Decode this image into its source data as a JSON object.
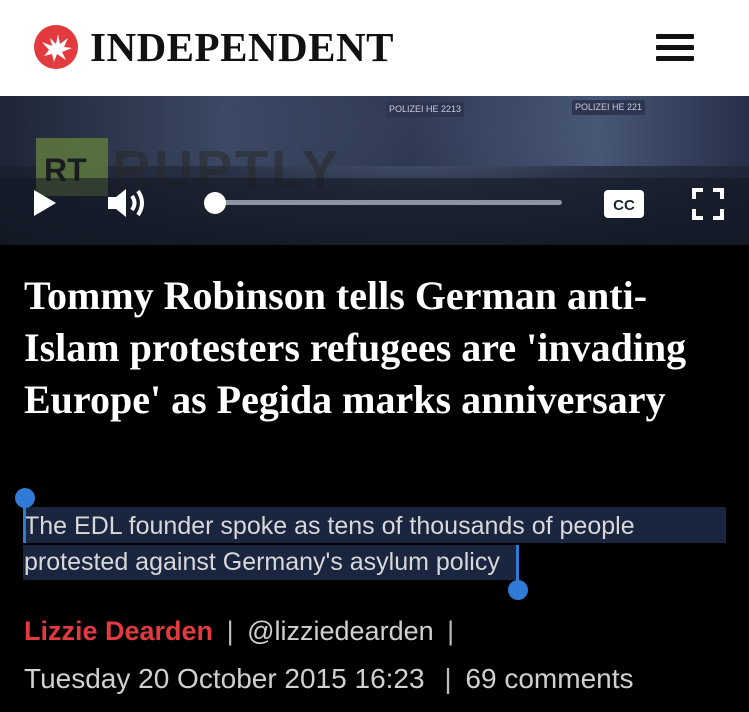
{
  "header": {
    "logo_text": "INDEPENDENT",
    "logo_icon": "eagle-icon",
    "menu_icon": "hamburger-menu-icon",
    "accent_color": "#e33a3f"
  },
  "video": {
    "watermark_badge": "RT",
    "watermark_text": "RUPTLY",
    "police_badges": [
      "POLIZEI HE 2213",
      "POLIZEI HE 221"
    ],
    "controls": {
      "play_icon": "play-icon",
      "volume_icon": "volume-icon",
      "progress": 0.0,
      "captions_label": "CC",
      "fullscreen_icon": "fullscreen-icon"
    }
  },
  "article": {
    "headline": "Tommy Robinson tells German anti-Islam protesters refugees are 'invading Europe' as Pegida marks anniversary",
    "standfirst": "The EDL founder spoke as tens of thousands of people protested against Germany's asylum policy",
    "author": "Lizzie Dearden",
    "handle": "@lizziedearden",
    "separator": "|",
    "date": "Tuesday 20 October 2015 16:23",
    "comments": "69 comments"
  }
}
